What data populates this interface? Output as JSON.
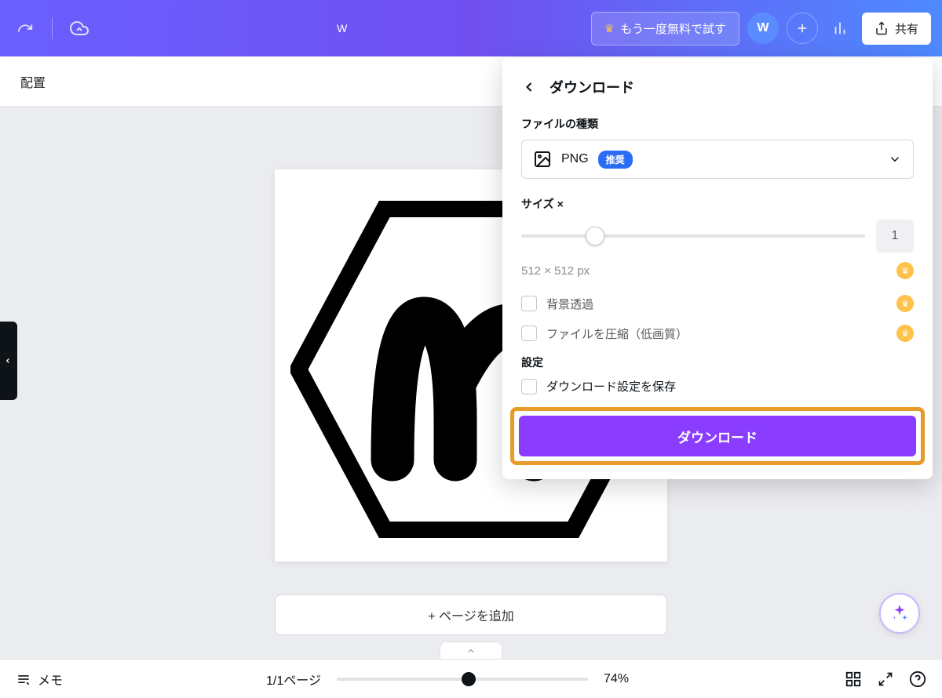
{
  "topbar": {
    "title": "W",
    "trial_label": "もう一度無料で試す",
    "avatar_letter": "W",
    "share_label": "共有"
  },
  "subbar": {
    "label": "配置"
  },
  "canvas": {
    "add_page_label": "+ ページを追加"
  },
  "popup": {
    "title": "ダウンロード",
    "filetype_label": "ファイルの種類",
    "filetype_value": "PNG",
    "recommended_badge": "推奨",
    "size_label": "サイズ",
    "size_multiplier": "×",
    "size_value": "1",
    "dimensions": "512 × 512 px",
    "option_transparent": "背景透過",
    "option_compress": "ファイルを圧縮（低画質）",
    "settings_label": "設定",
    "option_save_settings": "ダウンロード設定を保存",
    "download_button": "ダウンロード"
  },
  "bottombar": {
    "memo_label": "メモ",
    "page_indicator": "1/1ページ",
    "zoom_value": "74%"
  }
}
